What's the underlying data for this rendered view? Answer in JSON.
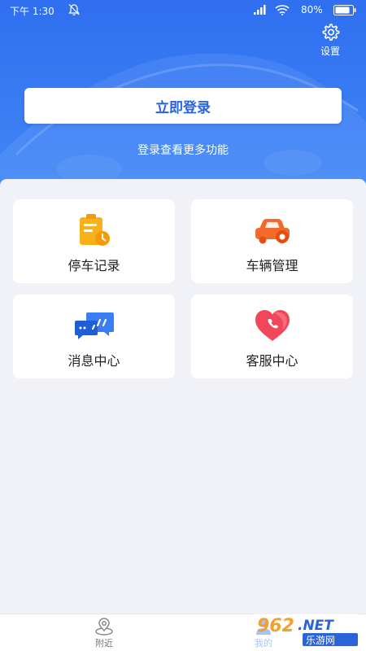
{
  "status_bar": {
    "time": "下午 1:30",
    "battery": "80%"
  },
  "header": {
    "settings_label": "设置",
    "login_button": "立即登录",
    "login_hint": "登录查看更多功能"
  },
  "features": [
    {
      "label": "停车记录",
      "icon": "parking-record-icon",
      "color": "#f7b21b"
    },
    {
      "label": "车辆管理",
      "icon": "car-icon",
      "color": "#f46a2a"
    },
    {
      "label": "消息中心",
      "icon": "message-icon",
      "color": "#3a7df4"
    },
    {
      "label": "客服中心",
      "icon": "heart-phone-icon",
      "color": "#f0485a"
    }
  ],
  "tabs": [
    {
      "label": "附近",
      "icon": "location-icon"
    },
    {
      "label": "我的",
      "icon": "user-icon"
    }
  ],
  "watermark": {
    "text": "962.NET",
    "subtext": "乐游网"
  },
  "colors": {
    "primary": "#3a7df4",
    "background": "#f1f2f7"
  }
}
